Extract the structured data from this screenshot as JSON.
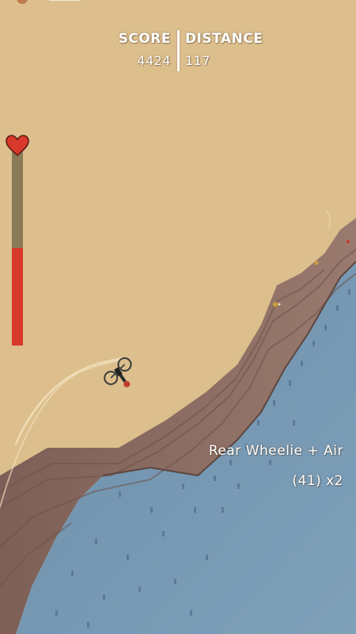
{
  "hud": {
    "score_label": "SCORE",
    "score_value": "4424",
    "distance_label": "DISTANCE",
    "distance_value": "117"
  },
  "health": {
    "level": 0.5,
    "icon": "heart-icon",
    "fill_color": "#d9392b",
    "track_color": "#8a7a57"
  },
  "trick": {
    "name": "Rear Wheelie + Air",
    "combo": "(41) x2"
  },
  "colors": {
    "sky": "#dcbf8d",
    "ramp_top": "#8c6b62",
    "ramp_side": "#6e8ea8"
  }
}
